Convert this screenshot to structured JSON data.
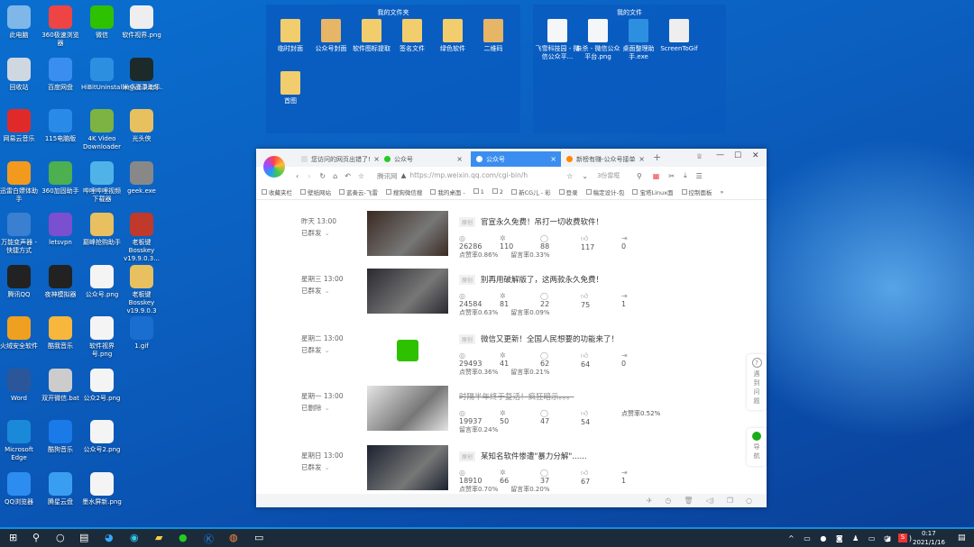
{
  "desktop": {
    "icons": [
      [
        "此电脑",
        "#7fb7e8"
      ],
      [
        "回收站",
        "#cfd8e0"
      ],
      [
        "网易云音乐",
        "#e02a2a"
      ],
      [
        "迅雷白嫖体助手",
        "#f29a1d"
      ],
      [
        "万能变声器 - 快捷方式",
        "#3a7fd0"
      ],
      [
        "腾讯QQ",
        "#222"
      ],
      [
        "火绒安全软件",
        "#f0a020"
      ],
      [
        "Word",
        "#2b579a"
      ],
      [
        "Microsoft Edge",
        "#1a8ad8"
      ],
      [
        "QQ浏览器",
        "#2d8cf0"
      ],
      [
        "360极速浏览器",
        "#e44"
      ],
      [
        "百度网盘",
        "#3a8ef0"
      ],
      [
        "115电脑版",
        "#2a8ae8"
      ],
      [
        "360加固助手",
        "#4caf50"
      ],
      [
        "letsvpn",
        "#7a4fd0"
      ],
      [
        "夜神模拟器",
        "#222"
      ],
      [
        "酷我音乐",
        "#f6b73c"
      ],
      [
        "双开微信.bat",
        "#ccc"
      ],
      [
        "酷狗音乐",
        "#1a7ae8"
      ],
      [
        "腾星云盘",
        "#3a9ef0"
      ],
      [
        "微信",
        "#2dc100"
      ],
      [
        "HiBitUninstaller_v2.5.15...",
        "#2d8fe0"
      ],
      [
        "4K Video Downloader",
        "#7cb342"
      ],
      [
        "哔哩哔哩视频下载器",
        "#4fb3e8"
      ],
      [
        "巅峰抢购助手",
        "#e8c060"
      ],
      [
        "公众号.png",
        "#f4f4f4"
      ],
      [
        "软件视界号.png",
        "#f4f4f4"
      ],
      [
        "公众2号.png",
        "#f4f4f4"
      ],
      [
        "公众号2.png",
        "#f4f4f4"
      ],
      [
        "墨水屏新.png",
        "#f4f4f4"
      ],
      [
        "软件视界.png",
        "#eee"
      ],
      [
        "米桌面录助手",
        "#1d2a2a"
      ],
      [
        "光头侠",
        "#e8c060"
      ],
      [
        "geek.exe",
        "#888"
      ],
      [
        "老板键Bosskey v19.9.0.3...",
        "#c0392b"
      ],
      [
        "老板键Bosskey v19.9.0.3",
        "#e8c060"
      ],
      [
        "1.gif",
        "#1a6ed0"
      ]
    ]
  },
  "fences": [
    {
      "title": "我的文件夹",
      "items": [
        "临时封面",
        "公众号封面",
        "软件图标提取",
        "签名文件",
        "绿色软件",
        "二维码",
        "首图"
      ]
    },
    {
      "title": "我的文件",
      "items": [
        "飞雪科技园 - 微信公众平...",
        "亲杀 - 微信公众平台.png",
        "桌面整理助手.exe",
        "ScreenToGif"
      ]
    }
  ],
  "browser": {
    "tabs": [
      {
        "label": "您访问的网页出错了!"
      },
      {
        "label": "公众号"
      },
      {
        "label": "公众号",
        "active": true
      },
      {
        "label": "新榜有赚-公众号接单"
      }
    ],
    "url_site": "腾讯网",
    "url": "https://mp.weixin.qq.com/cgi-bin/h",
    "search_text": "3份雷框",
    "bookmarks": [
      "收藏夹栏",
      "壁纸网站",
      "蓝奏云-飞雷",
      "搜狗微信搜",
      "我的桌面 -",
      "1",
      "2",
      "新CG儿 - 彩",
      "登录",
      "稿定设计-包",
      "宝塔Linux面",
      "控制面板"
    ],
    "articles": [
      {
        "date": "昨天 13:00",
        "status": "已群发",
        "badge": "原创",
        "title": "官宣永久免费！吊打一切收费软件！",
        "reads": "26286",
        "shares": "110",
        "comments": "88",
        "likes": "117",
        "forwards": "0",
        "like_rate": "点赞率0.86%",
        "comment_rate": "留言率0.33%",
        "thumb": "#3a2a22"
      },
      {
        "date": "星期三 13:00",
        "status": "已群发",
        "badge": "原创",
        "title": "别再用破解版了，这两款永久免费！",
        "reads": "24584",
        "shares": "81",
        "comments": "22",
        "likes": "75",
        "forwards": "1",
        "like_rate": "点赞率0.63%",
        "comment_rate": "留言率0.09%",
        "thumb": "#2a2a30"
      },
      {
        "date": "星期二 13:00",
        "status": "已群发",
        "badge": "原创",
        "title": "微信又更新！全国人民想要的功能来了！",
        "reads": "29493",
        "shares": "41",
        "comments": "62",
        "likes": "64",
        "forwards": "0",
        "like_rate": "点赞率0.36%",
        "comment_rate": "留言率0.21%",
        "thumb": "wechat"
      },
      {
        "date": "星期一 13:00",
        "status": "已删除",
        "badge": "",
        "title": "时隔半年终于复活！疯狂暗示。。。",
        "reads": "19937",
        "shares": "50",
        "comments": "47",
        "likes": "54",
        "forwards": "",
        "like_rate": "点赞率0.52%",
        "comment_rate": "留言率0.24%",
        "thumb": "#e4e4e4",
        "deleted": true
      },
      {
        "date": "星期日 13:00",
        "status": "已群发",
        "badge": "原创",
        "title": "某知名软件惨遭\"暴力分解\"......",
        "reads": "18910",
        "shares": "66",
        "comments": "37",
        "likes": "67",
        "forwards": "1",
        "like_rate": "点赞率0.70%",
        "comment_rate": "留言率0.20%",
        "thumb": "#1b2230"
      }
    ],
    "side_help": "遇到问题",
    "side_nav": "导航"
  },
  "taskbar": {
    "time": "0:17",
    "date": "2021/1/16",
    "ime": "中"
  }
}
